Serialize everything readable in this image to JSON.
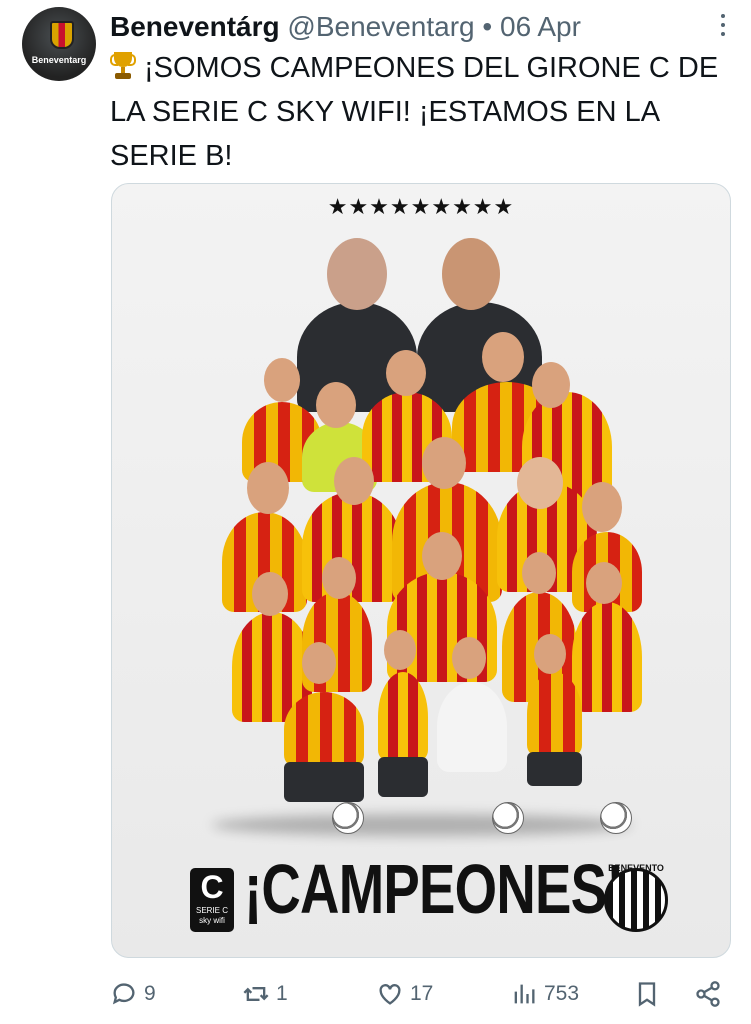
{
  "tweet": {
    "author_name": "Beneventárg",
    "handle": "@Beneventarg",
    "separator": "•",
    "date": "06 Apr",
    "avatar_caption": "Beneventarg",
    "text": "¡SOMOS CAMPEONES DEL GIRONE C DE LA SERIE C SKY WIFI! ¡ESTAMOS EN LA SERIE B!"
  },
  "media": {
    "stars": "★★★★★★★★★",
    "headline": "¡CAMPEONES!",
    "league_logo_mark": "C",
    "league_logo_text": "SERIE C",
    "league_logo_sub": "sky wifi",
    "club_logo_text": "BENEVENTO"
  },
  "actions": {
    "replies": "9",
    "reposts": "1",
    "likes": "17",
    "views": "753"
  },
  "icons": {
    "reply": "reply-icon",
    "repost": "repost-icon",
    "like": "heart-icon",
    "views": "views-icon",
    "bookmark": "bookmark-icon",
    "share": "share-icon",
    "more": "more-icon"
  },
  "colors": {
    "text": "#0f1419",
    "muted": "#536471",
    "kit_yellow": "#f2b705",
    "kit_red": "#d62212"
  }
}
